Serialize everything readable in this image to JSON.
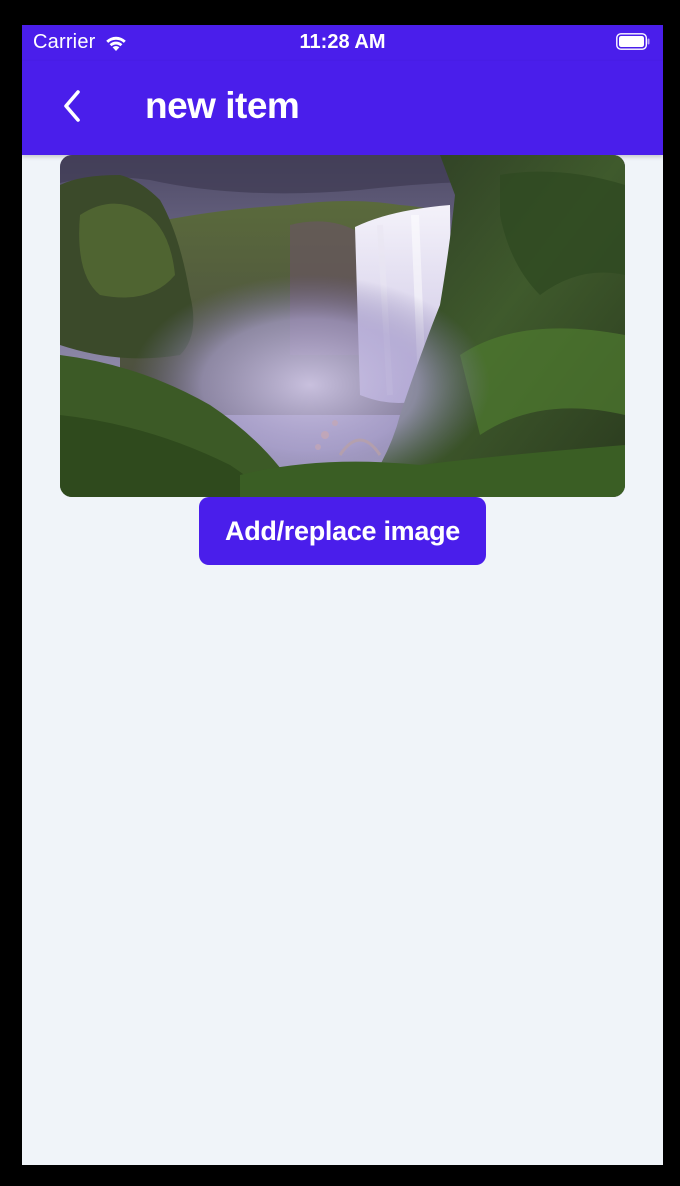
{
  "status_bar": {
    "carrier": "Carrier",
    "time": "11:28 AM",
    "wifi_icon": "wifi-icon",
    "battery_icon": "battery-icon"
  },
  "nav_bar": {
    "title": "new item",
    "back_icon": "chevron-left-icon"
  },
  "content": {
    "image": {
      "subject": "waterfall-photo"
    },
    "add_image_button_label": "Add/replace image"
  },
  "colors": {
    "accent": "#4A1EEB",
    "background": "#F0F4F9",
    "on_accent": "#FFFFFF"
  }
}
